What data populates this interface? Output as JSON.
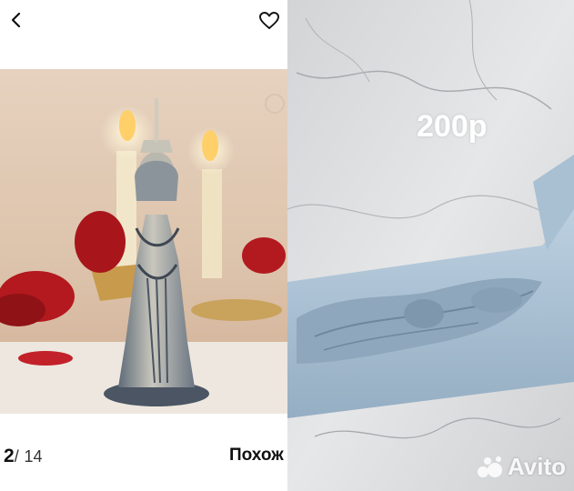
{
  "header": {
    "back_icon": "chevron-left-icon",
    "favorite_icon": "heart-outline-icon"
  },
  "gallery": {
    "current": "2",
    "separator": "/",
    "total": "14",
    "similar_label": "Похож"
  },
  "right_photo": {
    "price_overlay": "200р",
    "watermark": "Avito"
  },
  "colors": {
    "text": "#111111",
    "mold_blue": "#a9bfd1",
    "marble": "#d8dadc"
  }
}
